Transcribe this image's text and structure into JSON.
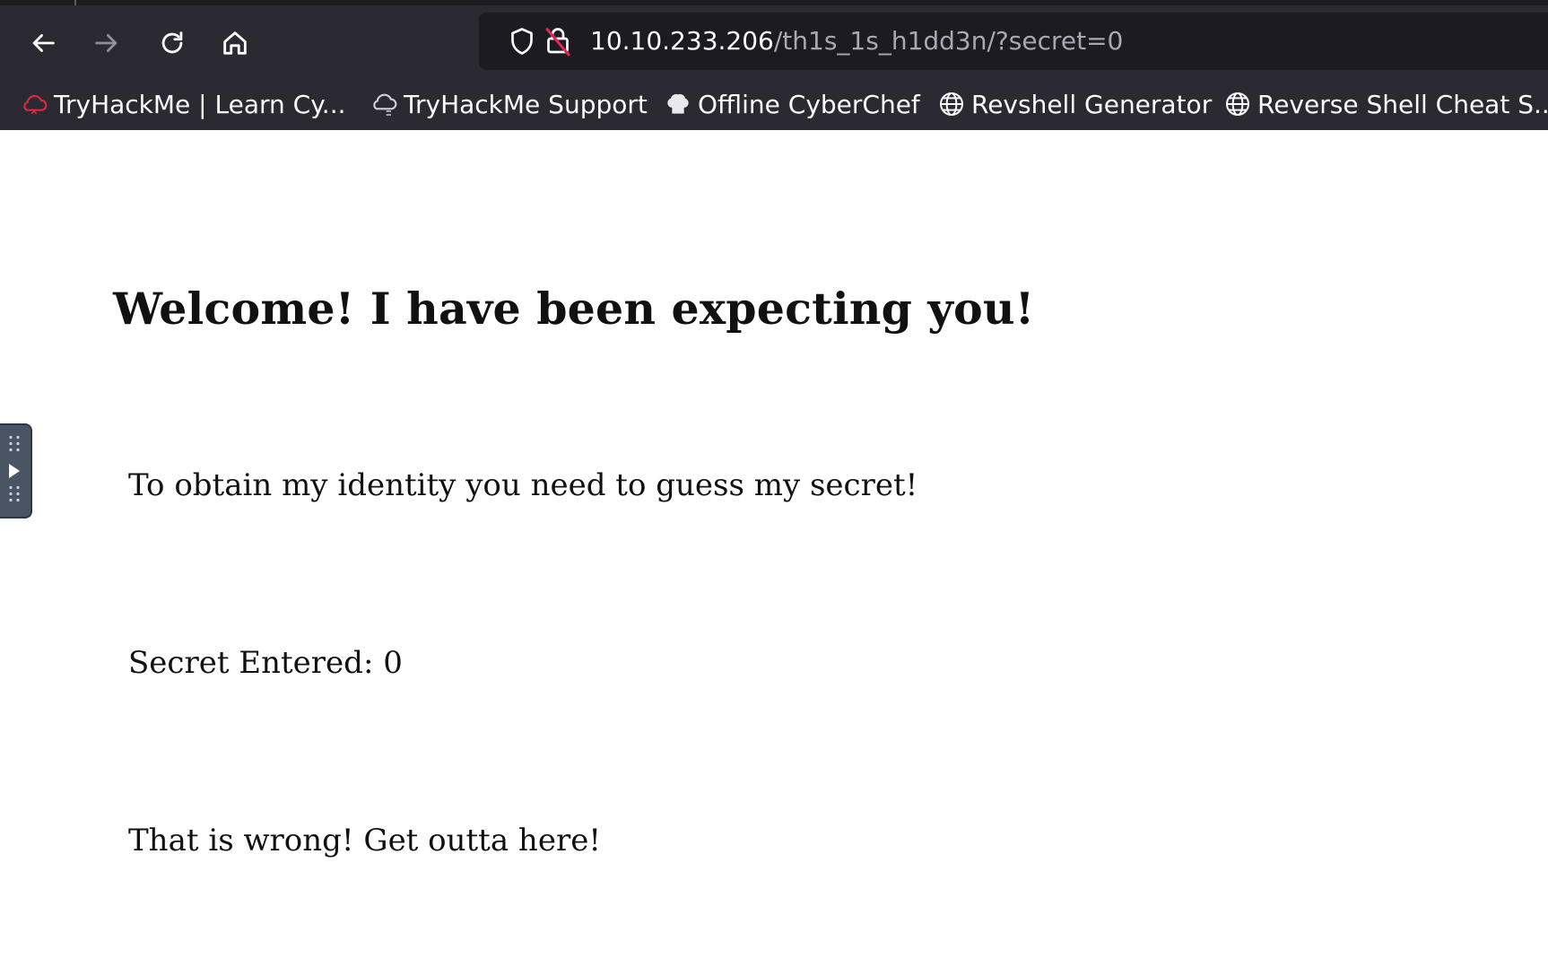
{
  "browser": {
    "nav": {
      "back_icon": "arrow-left-icon",
      "forward_icon": "arrow-right-icon",
      "reload_icon": "reload-icon",
      "home_icon": "home-icon"
    },
    "urlbar": {
      "host": "10.10.233.206",
      "path": "/th1s_1s_h1dd3n/?secret=0",
      "shield_icon": "shield-icon",
      "insecure_icon": "insecure-lock-icon"
    },
    "bookmarks": [
      {
        "label": "TryHackMe | Learn Cy...",
        "icon": "tryhackme-cloud-icon"
      },
      {
        "label": "TryHackMe Support",
        "icon": "cloud-icon"
      },
      {
        "label": "Offline CyberChef",
        "icon": "chef-hat-icon"
      },
      {
        "label": "Revshell Generator",
        "icon": "globe-icon"
      },
      {
        "label": "Reverse Shell Cheat S...",
        "icon": "globe-icon"
      }
    ]
  },
  "page": {
    "heading": "Welcome! I have been expecting you!",
    "paragraph1": "To obtain my identity you need to guess my secret!",
    "paragraph2": "Secret Entered: 0",
    "paragraph3": "That is wrong! Get outta here!"
  },
  "colors": {
    "toolbar_bg": "#2b2a33",
    "urlbar_bg": "#1c1b22",
    "toolbar_text": "#fbfbfe",
    "url_path": "#a8a8b3",
    "page_bg": "#ffffff"
  }
}
